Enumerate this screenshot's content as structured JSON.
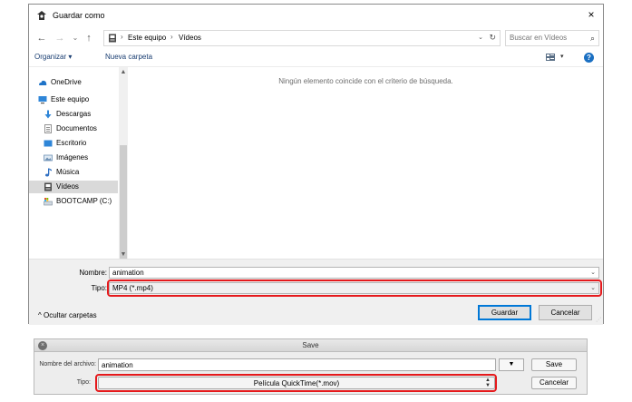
{
  "win_dialog": {
    "title": "Guardar como",
    "close_glyph": "×",
    "nav": {
      "back": "←",
      "forward": "→",
      "recent": "⌄",
      "up": "↑"
    },
    "breadcrumb": [
      {
        "label": "Este equipo"
      },
      {
        "label": "Vídeos"
      }
    ],
    "breadcrumb_sep": "›",
    "path_dropdown_glyph": "⌄",
    "refresh_glyph": "↻",
    "search_placeholder": "Buscar en Vídeos",
    "search_glyph": "⌕",
    "toolbar": {
      "organize": "Organizar ▾",
      "new_folder": "Nueva carpeta",
      "view_dd": "▾",
      "help": "?"
    },
    "sidebar": [
      {
        "label": "OneDrive",
        "icon": "onedrive-icon",
        "color": "#1e73c8"
      },
      {
        "label": "Este equipo",
        "icon": "computer-icon",
        "color": "#2f86d8"
      },
      {
        "label": "Descargas",
        "icon": "download-icon",
        "color": "#2f86d8"
      },
      {
        "label": "Documentos",
        "icon": "document-icon",
        "color": "#8a8a8a"
      },
      {
        "label": "Escritorio",
        "icon": "desktop-icon",
        "color": "#2f86d8"
      },
      {
        "label": "Imágenes",
        "icon": "pictures-icon",
        "color": "#6b8fb3"
      },
      {
        "label": "Música",
        "icon": "music-icon",
        "color": "#2f6fc2"
      },
      {
        "label": "Vídeos",
        "icon": "video-icon",
        "color": "#555555",
        "selected": true
      },
      {
        "label": "BOOTCAMP (C:)",
        "icon": "drive-icon",
        "color": "#4a90d9"
      }
    ],
    "scroll_up": "▲",
    "scroll_down": "▼",
    "empty_message": "Ningún elemento coincide con el criterio de búsqueda.",
    "filename_label": "Nombre:",
    "filename_value": "animation",
    "type_label": "Tipo:",
    "type_value": "MP4 (*.mp4)",
    "field_dd_glyph": "⌄",
    "hide_folders": "^  Ocultar carpetas",
    "save_button": "Guardar",
    "cancel_button": "Cancelar",
    "grip": "⋰"
  },
  "save_dialog": {
    "title": "Save",
    "close_glyph": "×",
    "filename_label": "Nombre del archivo:",
    "filename_value": "animation",
    "dropdown_glyph": "▼",
    "save_button": "Save",
    "type_label": "Tipo:",
    "type_value": "Película QuickTime(*.mov)",
    "stepper_up": "▲",
    "stepper_down": "▼",
    "cancel_button": "Cancelar"
  },
  "colors": {
    "highlight": "#e5191c",
    "accent": "#0078d7",
    "link": "#1a3e72"
  }
}
